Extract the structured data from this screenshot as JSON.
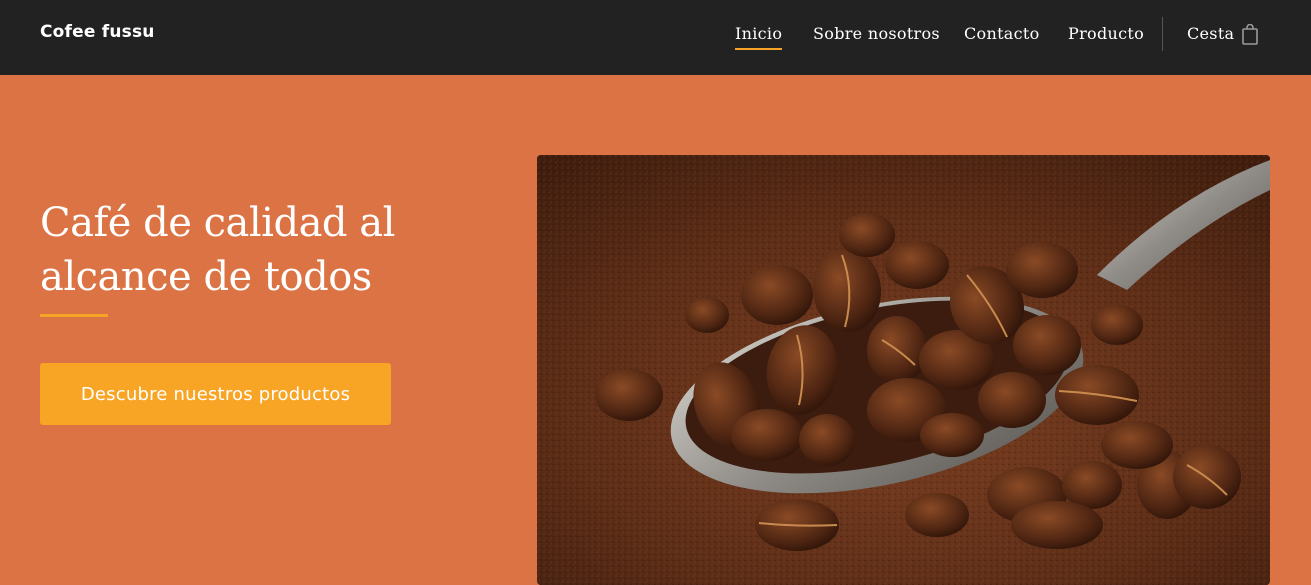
{
  "brand": {
    "name": "Cofee fussu"
  },
  "nav": {
    "items": [
      {
        "label": "Inicio",
        "active": true
      },
      {
        "label": "Sobre nosotros",
        "active": false
      },
      {
        "label": "Contacto",
        "active": false
      },
      {
        "label": "Producto",
        "active": false
      }
    ],
    "cart_label": "Cesta",
    "cart_icon": "shopping-bag-icon"
  },
  "hero": {
    "title": "Café de calidad al alcance de todos",
    "cta_label": "Descubre nuestros productos",
    "image_subject": "coffee-beans-on-spoon"
  },
  "colors": {
    "topbar": "#222222",
    "background": "#db7344",
    "accent": "#f5a425",
    "cta": "#f8a526",
    "text": "#ffffff"
  }
}
